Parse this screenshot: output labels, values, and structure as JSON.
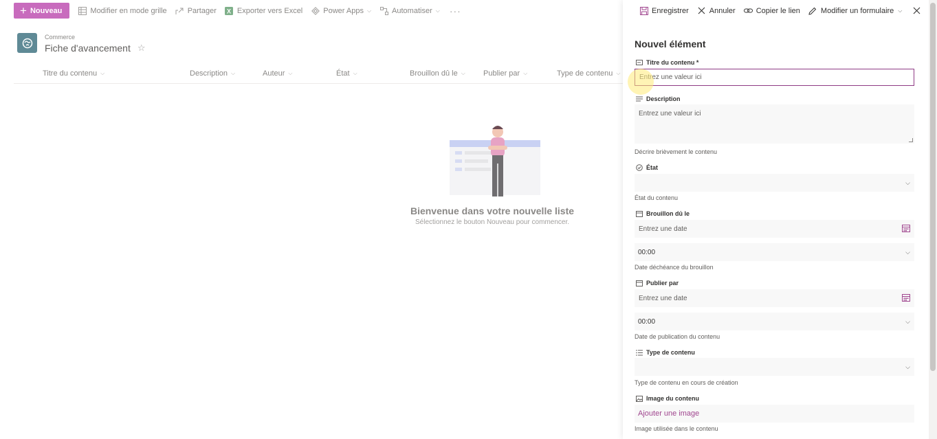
{
  "toolbar": {
    "new_label": "Nouveau",
    "grid_edit_label": "Modifier en mode grille",
    "share_label": "Partager",
    "export_label": "Exporter vers Excel",
    "powerapps_label": "Power Apps",
    "automate_label": "Automatiser",
    "more_label": "···"
  },
  "site": {
    "breadcrumb": "Commerce",
    "title": "Fiche d'avancement"
  },
  "list": {
    "columns": [
      "Titre du contenu",
      "Description",
      "Auteur",
      "État",
      "Brouillon dû le",
      "Publier par",
      "Type de contenu"
    ],
    "empty_title": "Bienvenue dans votre nouvelle liste",
    "empty_subtitle": "Sélectionnez le bouton Nouveau pour commencer."
  },
  "panel": {
    "save_label": "Enregistrer",
    "cancel_label": "Annuler",
    "copy_link_label": "Copier le lien",
    "edit_form_label": "Modifier un formulaire",
    "title": "Nouvel élément",
    "fields": {
      "content_title": {
        "label": "Titre du contenu *",
        "placeholder": "Entrez une valeur ici"
      },
      "description": {
        "label": "Description",
        "placeholder": "Entrez une valeur ici",
        "help": "Décrire brièvement le contenu"
      },
      "state": {
        "label": "État",
        "value": "",
        "help": "État du contenu"
      },
      "draft_due": {
        "label": "Brouillon dû le",
        "placeholder": "Entrez une date",
        "time": "00:00",
        "help": "Date déchéance du brouillon"
      },
      "publish_by": {
        "label": "Publier par",
        "placeholder": "Entrez une date",
        "time": "00:00",
        "help": "Date de publication du contenu"
      },
      "content_type": {
        "label": "Type de contenu",
        "value": "",
        "help": "Type de contenu en cours de création"
      },
      "content_image": {
        "label": "Image du contenu",
        "link": "Ajouter une image",
        "help": "Image utilisée dans le contenu"
      }
    }
  },
  "colors": {
    "accent": "#c86bbd",
    "focus_border": "#8e3a84",
    "link": "#a0468f"
  }
}
